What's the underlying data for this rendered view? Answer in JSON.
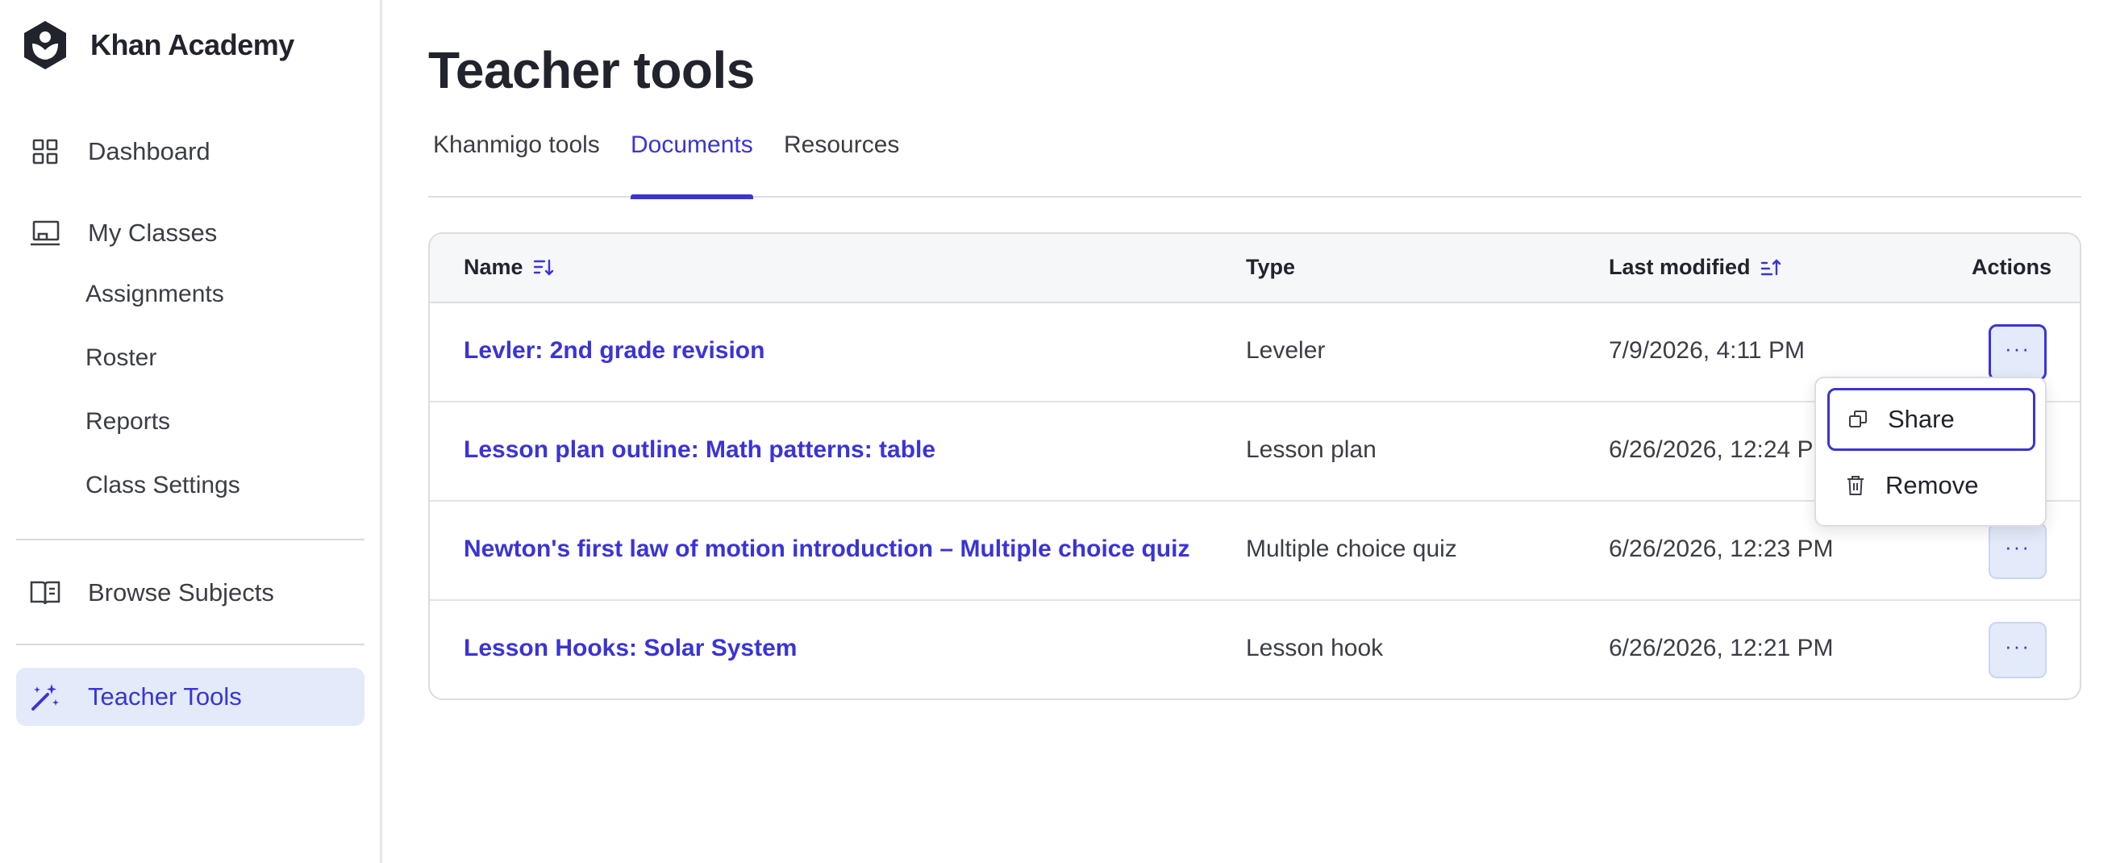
{
  "brand": {
    "name": "Khan Academy",
    "logo_icon": "khan-academy-logo"
  },
  "sidebar": {
    "items": [
      {
        "label": "Dashboard",
        "icon": "grid-icon"
      },
      {
        "label": "My Classes",
        "icon": "classroom-icon"
      },
      {
        "label": "Browse Subjects",
        "icon": "book-icon"
      },
      {
        "label": "Teacher Tools",
        "icon": "magic-wand-icon",
        "active": true
      }
    ],
    "class_subitems": [
      "Assignments",
      "Roster",
      "Reports",
      "Class Settings"
    ]
  },
  "main": {
    "title": "Teacher tools",
    "tabs": [
      {
        "label": "Khanmigo tools"
      },
      {
        "label": "Documents",
        "active": true
      },
      {
        "label": "Resources"
      }
    ],
    "table": {
      "headers": {
        "name": "Name",
        "type": "Type",
        "last_modified": "Last modified",
        "actions": "Actions"
      },
      "rows": [
        {
          "name": "Levler: 2nd grade revision",
          "type": "Leveler",
          "last_modified": "7/9/2026, 4:11 PM"
        },
        {
          "name": "Lesson plan outline: Math patterns: table",
          "type": "Lesson plan",
          "last_modified": "6/26/2026, 12:24 PM"
        },
        {
          "name": "Newton's first law of motion introduction – Multiple choice quiz",
          "type": "Multiple choice quiz",
          "last_modified": "6/26/2026, 12:23 PM"
        },
        {
          "name": "Lesson Hooks: Solar System",
          "type": "Lesson hook",
          "last_modified": "6/26/2026, 12:21 PM"
        }
      ],
      "actions_label": "···"
    },
    "menu": {
      "share": "Share",
      "remove": "Remove"
    }
  },
  "colors": {
    "accent": "#3a34d6",
    "active_bg": "#e3eaf9",
    "text": "#21242c"
  }
}
